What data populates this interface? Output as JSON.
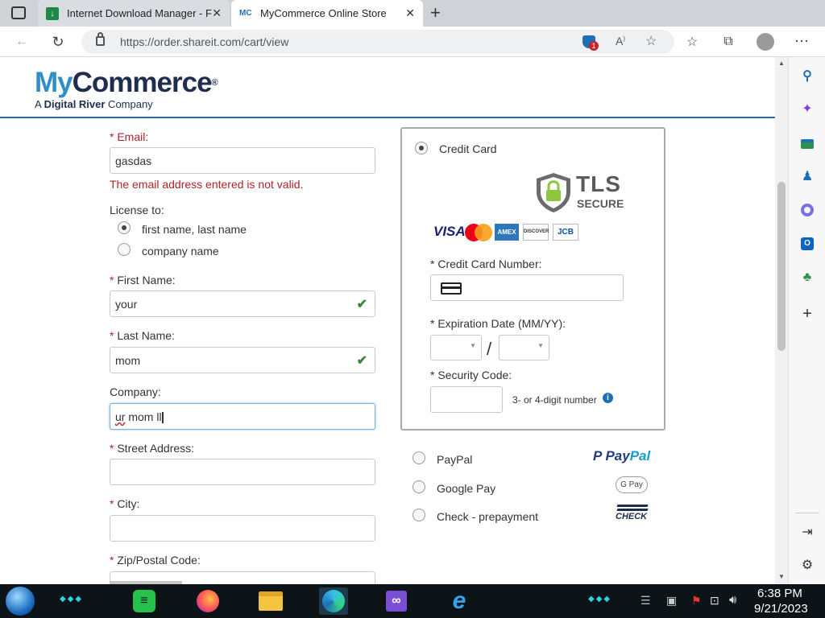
{
  "browser": {
    "tabs": [
      {
        "title": "Internet Download Manager - Fr",
        "favicon": "idm-icon"
      },
      {
        "title": "MyCommerce Online Store",
        "favicon": "MC"
      }
    ],
    "new_tab": "+",
    "url": "https://order.shareit.com/cart/view",
    "notification_badge": "1"
  },
  "logo": {
    "name_my": "My",
    "name_commerce": "Commerce",
    "mark": "®",
    "tagline_prefix": "A ",
    "tagline_bold": "Digital River",
    "tagline_suffix": " Company"
  },
  "form": {
    "required_mark": "* ",
    "email": {
      "label": "Email:",
      "value": "gasdas",
      "error": "The email address entered is not valid."
    },
    "license": {
      "label": "License to:",
      "options": [
        {
          "label": "first name, last name",
          "selected": true
        },
        {
          "label": "company name",
          "selected": false
        }
      ]
    },
    "first_name": {
      "label": "First Name:",
      "value": "your"
    },
    "last_name": {
      "label": "Last Name:",
      "value": "mom"
    },
    "company": {
      "label": "Company:",
      "value_part1": "ur",
      "value_part2": " mom ll"
    },
    "street": {
      "label": "Street Address:",
      "value": ""
    },
    "city": {
      "label": "City:",
      "value": ""
    },
    "zip": {
      "label": "Zip/Postal Code:",
      "value": ""
    }
  },
  "payment": {
    "credit_card": {
      "label": "Credit Card",
      "selected": true,
      "tls_title": "TLS",
      "tls_sub": "SECURE",
      "card_logos": [
        "VISA",
        "mastercard",
        "AMEX",
        "DISCOVER",
        "JCB"
      ],
      "number_label": "Credit Card Number:",
      "expiry_label": "Expiration Date (MM/YY):",
      "expiry_separator": "/",
      "security_label": "Security Code:",
      "security_hint": "3- or 4-digit number"
    },
    "other_methods": [
      {
        "label": "PayPal",
        "logo_text_1": "Pay",
        "logo_text_2": "Pal"
      },
      {
        "label": "Google Pay",
        "logo_text": "G Pay"
      },
      {
        "label": "Check - prepayment",
        "logo_text": "CHECK"
      }
    ]
  },
  "taskbar": {
    "time": "6:38 PM",
    "date": "9/21/2023"
  },
  "colors": {
    "accent_blue": "#1e6fb8",
    "brand_navy": "#1f2d4e",
    "brand_light_blue": "#2d8ec9",
    "error_red": "#b0232b",
    "check_green": "#3a8a3a",
    "paypal_blue": "#253b80",
    "paypal_light": "#179bd7"
  }
}
